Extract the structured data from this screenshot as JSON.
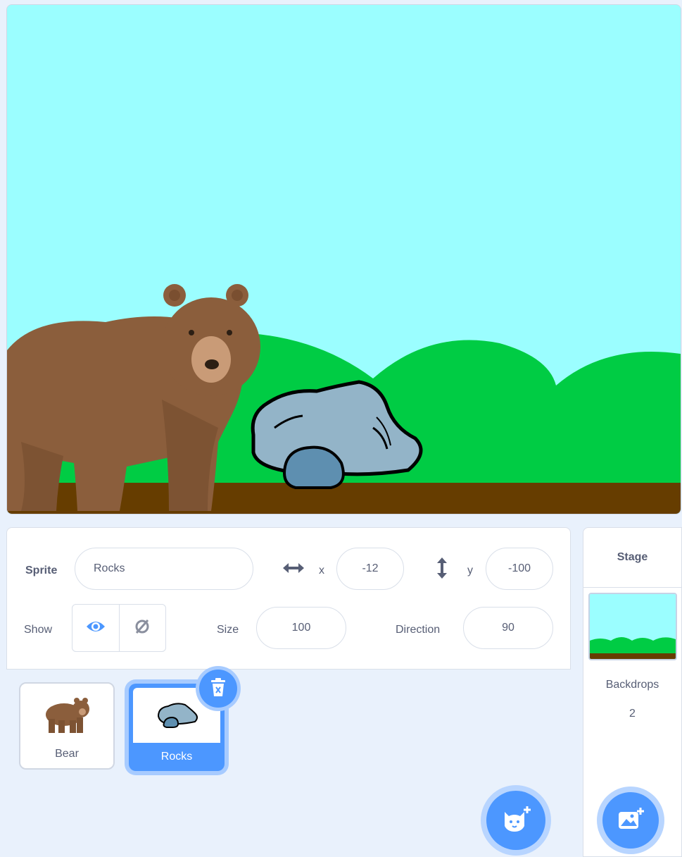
{
  "stage": {
    "colors": {
      "sky": "#9bfeff",
      "hills": "#00cc44",
      "ground": "#663d00",
      "bear": "#8b5e3c",
      "rock": "#93b4c8",
      "rock_dark": "#5e8fb0"
    }
  },
  "sprite_info": {
    "sprite_label": "Sprite",
    "sprite_name": "Rocks",
    "x_label": "x",
    "x_value": "-12",
    "y_label": "y",
    "y_value": "-100",
    "show_label": "Show",
    "size_label": "Size",
    "size_value": "100",
    "direction_label": "Direction",
    "direction_value": "90"
  },
  "sprites": [
    {
      "name": "Bear",
      "icon": "bear-sprite-icon",
      "selected": false
    },
    {
      "name": "Rocks",
      "icon": "rocks-sprite-icon",
      "selected": true
    }
  ],
  "stage_pane": {
    "title": "Stage",
    "backdrops_label": "Backdrops",
    "backdrops_count": "2"
  },
  "colors": {
    "accent": "#4c97ff",
    "accent_light": "#a7cbff",
    "text": "#575e75"
  }
}
